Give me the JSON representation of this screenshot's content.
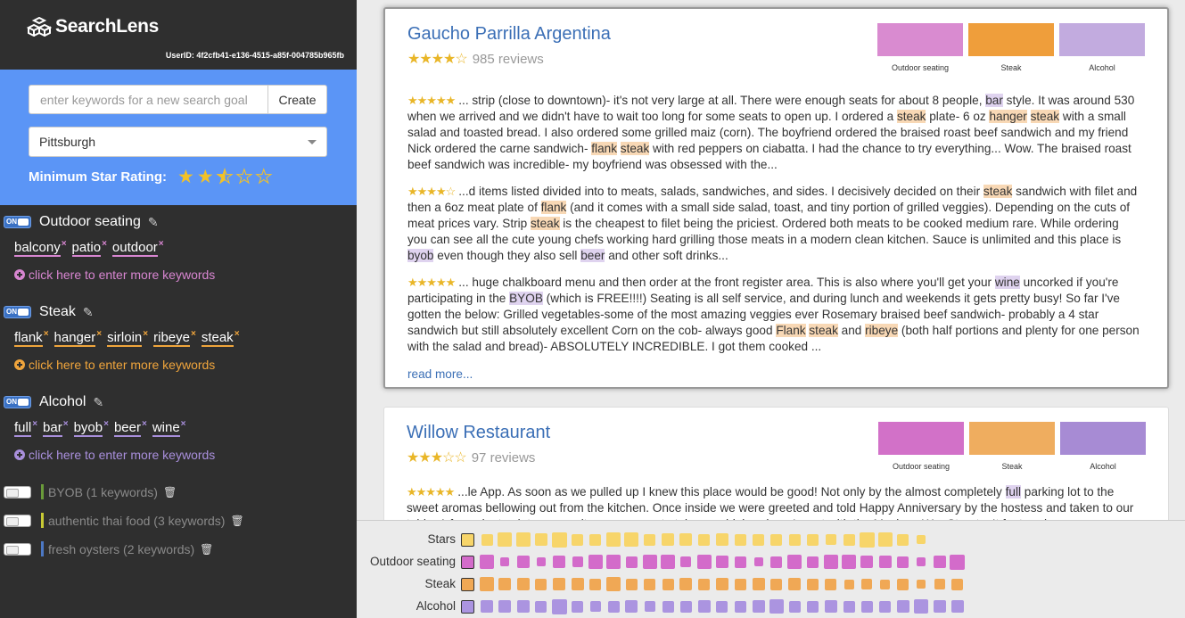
{
  "app": {
    "name": "SearchLens",
    "user_id": "UserID: 4f2cfb41-e136-4515-a85f-004785b965fb"
  },
  "search": {
    "goal_placeholder": "enter keywords for a new search goal",
    "create_label": "Create",
    "city": "Pittsburgh",
    "min_rating_label": "Minimum Star Rating:",
    "min_rating_value": 2.5
  },
  "categories": [
    {
      "name": "Outdoor seating",
      "color": "#d886d1",
      "state": "ON",
      "keywords": [
        "balcony",
        "patio",
        "outdoor"
      ],
      "add_label": "click here to enter more keywords"
    },
    {
      "name": "Steak",
      "color": "#f0a53c",
      "state": "ON",
      "keywords": [
        "flank",
        "hanger",
        "sirloin",
        "ribeye",
        "steak"
      ],
      "add_label": "click here to enter more keywords"
    },
    {
      "name": "Alcohol",
      "color": "#a98fdc",
      "state": "ON",
      "keywords": [
        "full",
        "bar",
        "byob",
        "beer",
        "wine"
      ],
      "add_label": "click here to enter more keywords"
    }
  ],
  "inactive_goals": [
    {
      "label": "BYOB (1 keywords)",
      "color": "#6a9b3a"
    },
    {
      "label": "authentic thai food (3 keywords)",
      "color": "#c7c934"
    },
    {
      "label": "fresh oysters (2 keywords)",
      "color": "#4c78c4"
    }
  ],
  "restaurants": [
    {
      "name": "Gaucho Parrilla Argentina",
      "rating": 4.5,
      "stars": "★★★★☆",
      "reviews": "985 reviews",
      "swatches": [
        {
          "label": "Outdoor seating",
          "color": "#d98bd0"
        },
        {
          "label": "Steak",
          "color": "#ef9e3b"
        },
        {
          "label": "Alcohol",
          "color": "#c2abdf"
        }
      ],
      "review_snippets": [
        {
          "stars": "★★★★★",
          "segments": [
            [
              "... strip (close to downtown)- it's not very large at all. There were enough seats for about 8 people, ",
              ""
            ],
            [
              "bar",
              "alc"
            ],
            [
              " style. It was around 530 when we arrived and we didn't have to wait too long for some seats to open up. I ordered a ",
              ""
            ],
            [
              "steak",
              "steak"
            ],
            [
              " plate- 6 oz ",
              ""
            ],
            [
              "hanger",
              "steak"
            ],
            [
              " ",
              ""
            ],
            [
              "steak",
              "steak"
            ],
            [
              " with a small salad and toasted bread. I also ordered some grilled maiz (corn). The boyfriend ordered the braised roast beef sandwich and my friend Nick ordered the carne sandwich- ",
              ""
            ],
            [
              "flank",
              "steak"
            ],
            [
              " ",
              ""
            ],
            [
              "steak",
              "steak"
            ],
            [
              " with red peppers on ciabatta. I had the chance to try everything... Wow. The braised roast beef sandwich was incredible- my boyfriend was obsessed with the...",
              ""
            ]
          ]
        },
        {
          "stars": "★★★★☆",
          "segments": [
            [
              "...d items listed divided into to meats, salads, sandwiches, and sides. I decisively decided on their ",
              ""
            ],
            [
              "steak",
              "steak"
            ],
            [
              " sandwich with filet and then a 6oz meat plate of ",
              ""
            ],
            [
              "flank",
              "steak"
            ],
            [
              " (and it comes with a small side salad, toast, and tiny portion of grilled veggies). Depending on the cuts of meat prices vary. Strip ",
              ""
            ],
            [
              "steak",
              "steak"
            ],
            [
              " is the cheapest to filet being the priciest. Ordered both meats to be cooked medium rare. While ordering you can see all the cute young chefs working hard grilling those meats in a modern clean kitchen. Sauce is unlimited and this place is ",
              ""
            ],
            [
              "byob",
              "alc"
            ],
            [
              " even though they also sell ",
              ""
            ],
            [
              "beer",
              "alc"
            ],
            [
              " and other soft drinks...",
              ""
            ]
          ]
        },
        {
          "stars": "★★★★★",
          "segments": [
            [
              "... huge chalkboard menu and then order at the front register area. This is also where you'll get your ",
              ""
            ],
            [
              "wine",
              "alc"
            ],
            [
              " uncorked if you're participating in the ",
              ""
            ],
            [
              "BYOB",
              "alc"
            ],
            [
              " (which is FREE!!!!) Seating is all self service, and during lunch and weekends it gets pretty busy! So far I've gotten the below: Grilled vegetables-some of the most amazing veggies ever Rosemary braised beef sandwich- probably a 4 star sandwich but still absolutely excellent Corn on the cob- always good ",
              ""
            ],
            [
              "Flank",
              "steak"
            ],
            [
              " ",
              ""
            ],
            [
              "steak",
              "steak"
            ],
            [
              " and ",
              ""
            ],
            [
              "ribeye",
              "steak"
            ],
            [
              " (both half portions and plenty for one person with the salad and bread)- ABSOLUTELY INCREDIBLE. I got them cooked ...",
              ""
            ]
          ]
        }
      ],
      "read_more": "read more..."
    },
    {
      "name": "Willow Restaurant",
      "rating": 3.5,
      "stars": "★★★☆☆",
      "reviews": "97 reviews",
      "swatches": [
        {
          "label": "Outdoor seating",
          "color": "#d271c8"
        },
        {
          "label": "Steak",
          "color": "#efad5f"
        },
        {
          "label": "Alcohol",
          "color": "#a78bd4"
        }
      ],
      "review_snippets": [
        {
          "stars": "★★★★★",
          "segments": [
            [
              "...le App. As soon as we pulled up I knew this place would be good! Not only by the almost completely ",
              ""
            ],
            [
              "full",
              "alc"
            ],
            [
              " parking lot to the sweet aromas bellowing out from the kitchen. Once inside we were greeted and told Happy Anniversary by the hostess and taken to our table. A few minutes later our waiter came over to take our drink orders. I went with the Mexican War Streets. It featured",
              ""
            ]
          ]
        }
      ]
    }
  ],
  "matrix": {
    "rows": [
      {
        "label": "Stars",
        "color": "#f7d56a",
        "values": [
          0.6,
          0.8,
          0.8,
          0.7,
          0.9,
          0.6,
          0.6,
          0.8,
          0.8,
          0.6,
          0.7,
          0.7,
          0.6,
          0.7,
          0.6,
          0.6,
          0.6,
          0.6,
          0.6,
          0.5,
          0.6,
          0.9,
          0.8,
          0.6,
          0.3
        ]
      },
      {
        "label": "Outdoor seating",
        "color": "#d36bca",
        "values": [
          0.8,
          0.3,
          0.7,
          0.3,
          0.7,
          0.5,
          0.8,
          0.8,
          0.6,
          0.8,
          0.8,
          0.5,
          0.8,
          0.7,
          0.6,
          0.3,
          0.6,
          0.8,
          0.6,
          0.8,
          0.8,
          0.7,
          0.7,
          0.6,
          0.3,
          0.7,
          0.9
        ]
      },
      {
        "label": "Steak",
        "color": "#f0a855",
        "values": [
          0.8,
          0.7,
          0.7,
          0.6,
          0.7,
          0.7,
          0.6,
          0.8,
          0.6,
          0.6,
          0.6,
          0.7,
          0.6,
          0.7,
          0.6,
          0.7,
          0.6,
          0.7,
          0.6,
          0.6,
          0.4,
          0.5,
          0.4,
          0.6,
          0.3,
          0.5,
          0.6
        ]
      },
      {
        "label": "Alcohol",
        "color": "#ab94e0",
        "values": [
          0.7,
          0.7,
          0.7,
          0.6,
          0.9,
          0.6,
          0.5,
          0.6,
          0.7,
          0.5,
          0.6,
          0.6,
          0.7,
          0.6,
          0.6,
          0.7,
          0.8,
          0.6,
          0.6,
          0.7,
          0.6,
          0.6,
          0.6,
          0.7,
          0.8,
          0.7,
          0.7
        ]
      }
    ]
  }
}
